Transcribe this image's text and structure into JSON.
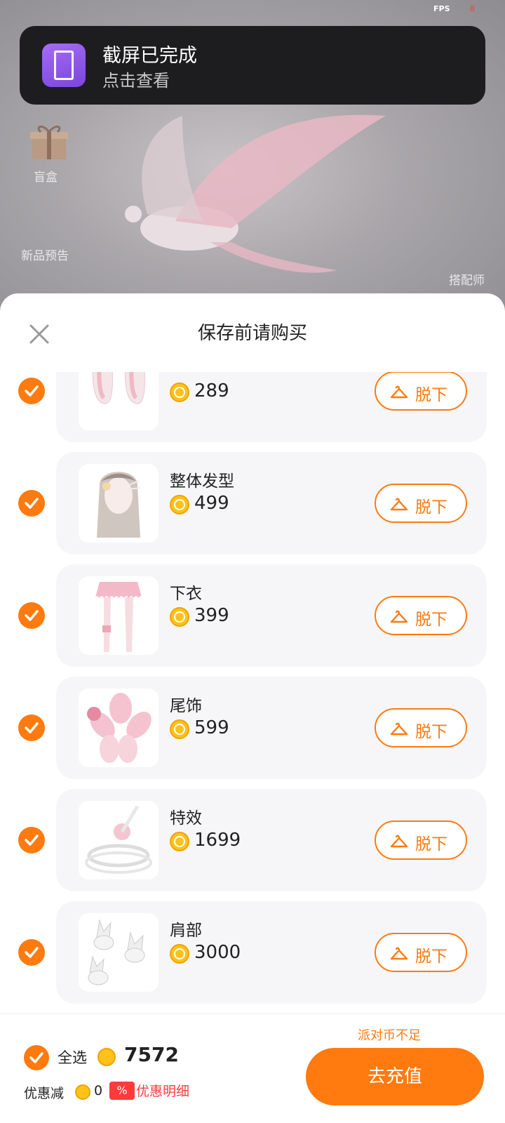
{
  "status_bar": {
    "fps_label": "FPS",
    "indicator": "8"
  },
  "background": {
    "gift_label": "盲盒",
    "left_item_label": "新品预告",
    "right_item_label": "搭配师"
  },
  "toast": {
    "title": "截屏已完成",
    "subtitle": "点击查看",
    "icon": "screenshot-icon"
  },
  "sheet": {
    "title": "保存前请购买",
    "close_icon": "close-icon",
    "remove_label": "脱下",
    "items": [
      {
        "name": "",
        "price": "289",
        "thumb": "bunny-ears"
      },
      {
        "name": "整体发型",
        "price": "499",
        "thumb": "hairstyle"
      },
      {
        "name": "下衣",
        "price": "399",
        "thumb": "skirt-legs"
      },
      {
        "name": "尾饰",
        "price": "599",
        "thumb": "tail"
      },
      {
        "name": "特效",
        "price": "1699",
        "thumb": "effect"
      },
      {
        "name": "肩部",
        "price": "3000",
        "thumb": "shoulder-foxes"
      }
    ]
  },
  "footer": {
    "select_all_label": "全选",
    "total": "7572",
    "discount_label": "优惠减",
    "discount_value": "0",
    "discount_badge": "%",
    "discount_detail": "优惠明细",
    "insufficient_text": "派对币不足",
    "recharge_button": "去充值"
  },
  "colors": {
    "accent": "#ff7a0f",
    "coin": "#ffc21a",
    "danger": "#ff3b3b",
    "toast_bg": "#1d1d1f"
  }
}
